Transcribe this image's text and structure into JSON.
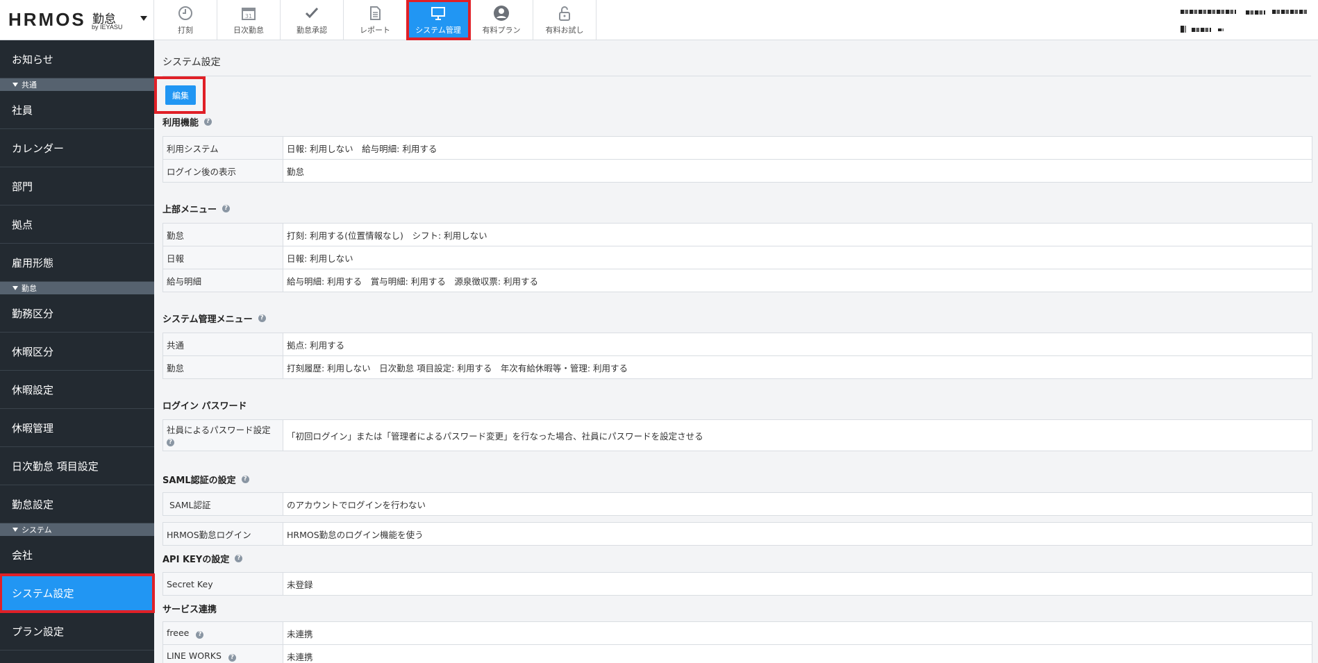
{
  "header": {
    "logo_main": "HRMOS",
    "logo_sub": "勤怠",
    "logo_by": "by IEYASU",
    "tabs": [
      {
        "label": "打刻",
        "icon": "clock-icon"
      },
      {
        "label": "日次勤怠",
        "icon": "calendar-icon"
      },
      {
        "label": "勤怠承認",
        "icon": "check-icon"
      },
      {
        "label": "レポート",
        "icon": "document-icon"
      },
      {
        "label": "システム管理",
        "icon": "monitor-icon",
        "active": true
      },
      {
        "label": "有料プラン",
        "icon": "user-icon"
      },
      {
        "label": "有料お試し",
        "icon": "unlock-icon"
      }
    ]
  },
  "sidebar": {
    "top_item": "お知らせ",
    "sections": [
      {
        "title": "共通",
        "items": [
          "社員",
          "カレンダー",
          "部門",
          "拠点",
          "雇用形態"
        ]
      },
      {
        "title": "勤怠",
        "items": [
          "勤務区分",
          "休暇区分",
          "休暇設定",
          "休暇管理",
          "日次勤怠 項目設定",
          "勤怠設定"
        ]
      },
      {
        "title": "システム",
        "items": [
          "会社",
          "システム設定",
          "プラン設定"
        ]
      }
    ],
    "active_item": "システム設定"
  },
  "main": {
    "title": "システム設定",
    "edit_label": "編集",
    "sections": {
      "features": {
        "title": "利用機能",
        "rows": [
          {
            "key": "利用システム",
            "value": "日報: 利用しない　給与明細: 利用する"
          },
          {
            "key": "ログイン後の表示",
            "value": "勤怠"
          }
        ]
      },
      "top_menu": {
        "title": "上部メニュー",
        "rows": [
          {
            "key": "勤怠",
            "value": "打刻: 利用する(位置情報なし)　シフト: 利用しない"
          },
          {
            "key": "日報",
            "value": "日報: 利用しない"
          },
          {
            "key": "給与明細",
            "value": "給与明細: 利用する　賞与明細: 利用する　源泉徴収票: 利用する"
          }
        ]
      },
      "system_menu": {
        "title": "システム管理メニュー",
        "rows": [
          {
            "key": "共通",
            "value": "拠点: 利用する"
          },
          {
            "key": "勤怠",
            "value": "打刻履歴: 利用しない　日次勤怠 項目設定: 利用する　年次有給休暇等・管理: 利用する"
          }
        ]
      },
      "login_password": {
        "title": "ログイン パスワード",
        "rows": [
          {
            "key": "社員によるパスワード設定",
            "value": "「初回ログイン」または「管理者によるパスワード変更」を行なった場合、社員にパスワードを設定させる"
          }
        ]
      },
      "saml": {
        "title": "SAML認証の設定",
        "rows": [
          {
            "key": "SAML認証",
            "value": "のアカウントでログインを行わない"
          },
          {
            "key": "HRMOS勤怠ログイン",
            "value": "HRMOS勤怠のログイン機能を使う"
          }
        ]
      },
      "api_key": {
        "title": "API KEYの設定",
        "rows": [
          {
            "key": "Secret Key",
            "value": "未登録"
          }
        ]
      },
      "service": {
        "title": "サービス連携",
        "rows": [
          {
            "key": "freee",
            "value": "未連携"
          },
          {
            "key": "LINE WORKS",
            "value": "未連携"
          }
        ]
      }
    }
  },
  "colors": {
    "accent": "#2196f3",
    "highlight": "#e02027",
    "sidebar_bg": "#232a31",
    "section_bg": "#56626f"
  }
}
